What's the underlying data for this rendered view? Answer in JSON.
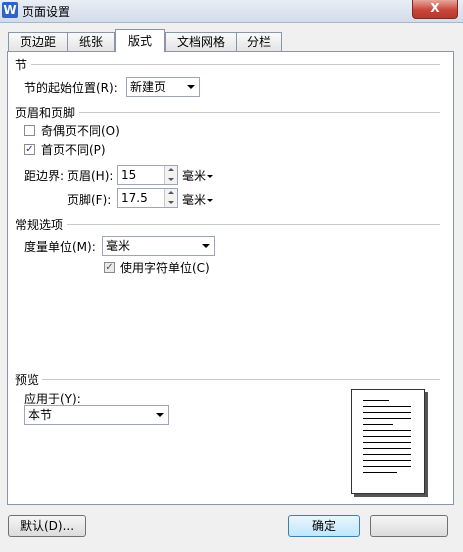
{
  "window": {
    "title": "页面设置",
    "app_icon_letter": "W",
    "close_label": "X"
  },
  "tabs": [
    {
      "label": "页边距"
    },
    {
      "label": "纸张"
    },
    {
      "label": "版式",
      "active": true
    },
    {
      "label": "文档网格"
    },
    {
      "label": "分栏"
    }
  ],
  "section": {
    "heading": "节",
    "start_label": "节的起始位置(R):",
    "start_value": "新建页"
  },
  "header_footer": {
    "heading": "页眉和页脚",
    "odd_even_label": "奇偶页不同(O)",
    "odd_even_checked": false,
    "first_page_label": "首页不同(P)",
    "first_page_checked": true,
    "distance_label": "距边界:",
    "header_label": "页眉(H):",
    "header_value": "15",
    "footer_label": "页脚(F):",
    "footer_value": "17.5",
    "unit": "毫米"
  },
  "general": {
    "heading": "常规选项",
    "measure_label": "度量单位(M):",
    "measure_value": "毫米",
    "char_units_label": "使用字符单位(C)",
    "char_units_checked": true
  },
  "preview": {
    "heading": "预览",
    "apply_label": "应用于(Y):",
    "apply_value": "本节"
  },
  "buttons": {
    "default_label": "默认(D)...",
    "ok_label": "确定"
  }
}
